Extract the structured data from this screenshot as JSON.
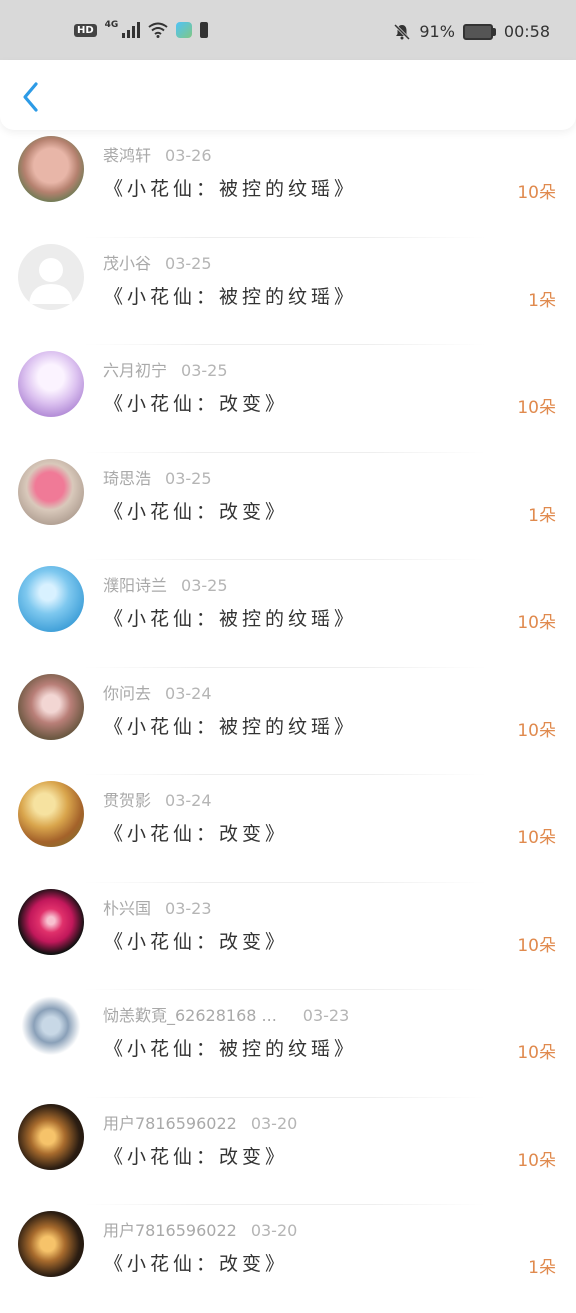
{
  "status_bar": {
    "hd": "HD",
    "network": "4G",
    "battery_pct": "91%",
    "time": "00:58"
  },
  "nav": {
    "back_icon": "chevron-left-icon",
    "accent": "#2d9be6"
  },
  "colors": {
    "count": "#e08a4e",
    "name": "#a9a9a9",
    "title": "#333333"
  },
  "gifts": [
    {
      "user": "裘鸿轩",
      "date": "03-26",
      "title": "《小花仙：被控的纹瑶》",
      "count": "10朵",
      "avatar": "pig-avatar"
    },
    {
      "user": "茂小谷",
      "date": "03-25",
      "title": "《小花仙：被控的纹瑶》",
      "count": "1朵",
      "avatar": "default-avatar"
    },
    {
      "user": "六月初宁",
      "date": "03-25",
      "title": "《小花仙：改变》",
      "count": "10朵",
      "avatar": "anime-girl-avatar"
    },
    {
      "user": "琦思浩",
      "date": "03-25",
      "title": "《小花仙：改变》",
      "count": "1朵",
      "avatar": "pony-avatar"
    },
    {
      "user": "濮阳诗兰",
      "date": "03-25",
      "title": "《小花仙：被控的纹瑶》",
      "count": "10朵",
      "avatar": "sky-avatar"
    },
    {
      "user": "你问去",
      "date": "03-24",
      "title": "《小花仙：被控的纹瑶》",
      "count": "10朵",
      "avatar": "blossom-avatar"
    },
    {
      "user": "贯贺影",
      "date": "03-24",
      "title": "《小花仙：改变》",
      "count": "10朵",
      "avatar": "sunset-avatar"
    },
    {
      "user": "朴兴国",
      "date": "03-23",
      "title": "《小花仙：改变》",
      "count": "10朵",
      "avatar": "orchid-avatar"
    },
    {
      "user": "恸恙歎覔_62628168 ...",
      "date": "03-23",
      "title": "《小花仙：被控的纹瑶》",
      "count": "10朵",
      "avatar": "anime-character-avatar"
    },
    {
      "user": "用户7816596022",
      "date": "03-20",
      "title": "《小花仙：改变》",
      "count": "10朵",
      "avatar": "fairy-avatar"
    },
    {
      "user": "用户7816596022",
      "date": "03-20",
      "title": "《小花仙：改变》",
      "count": "1朵",
      "avatar": "fairy-avatar"
    }
  ]
}
